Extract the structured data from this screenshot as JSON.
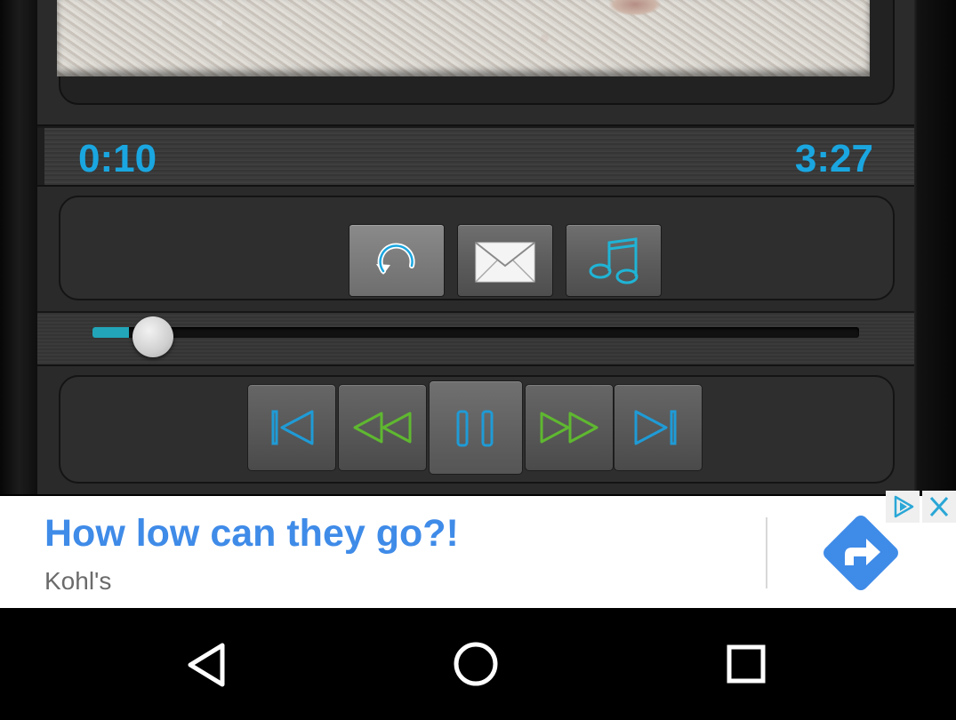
{
  "player": {
    "elapsed_time": "0:10",
    "total_time": "3:27",
    "progress_fraction": 0.048,
    "accent_color": "#1aa6e0",
    "actions": [
      {
        "icon": "repeat-icon"
      },
      {
        "icon": "mail-icon"
      },
      {
        "icon": "music-note-icon"
      }
    ],
    "transport": [
      {
        "icon": "skip-previous-icon"
      },
      {
        "icon": "rewind-icon"
      },
      {
        "icon": "pause-icon"
      },
      {
        "icon": "fast-forward-icon"
      },
      {
        "icon": "skip-next-icon"
      }
    ],
    "transport_icon_colors": {
      "skip": "#1f9bd6",
      "seek": "#5fb830",
      "pause": "#1f9bd6"
    }
  },
  "ad": {
    "headline": "How low can they go?!",
    "advertiser": "Kohl's",
    "headline_color": "#3f8be8",
    "cta_icon": "forward-arrow-icon",
    "adchoices_icon": "adchoices-icon",
    "close_icon": "close-icon"
  },
  "navigation": {
    "buttons": [
      "back-icon",
      "home-icon",
      "recents-icon"
    ]
  }
}
